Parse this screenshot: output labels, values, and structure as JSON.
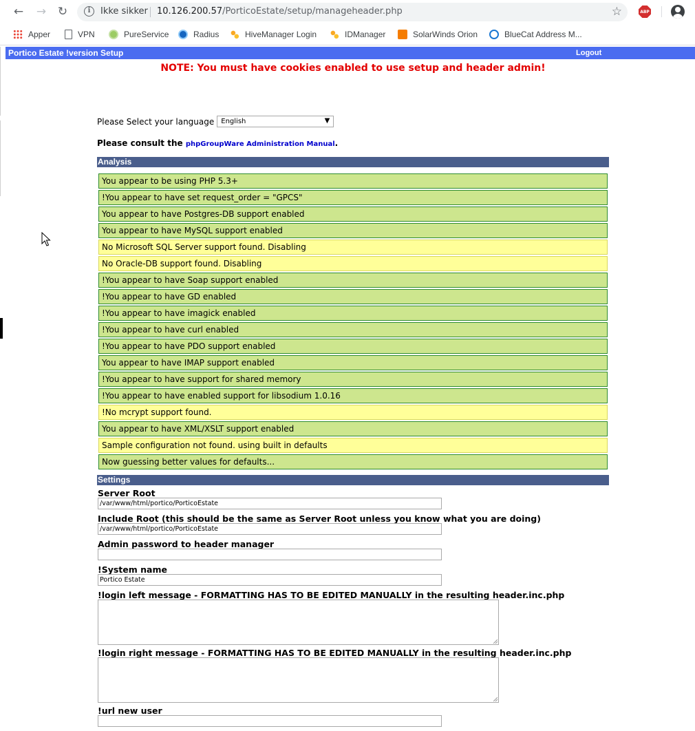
{
  "browser": {
    "nav": {
      "back": "←",
      "forward": "→",
      "reload": "↻"
    },
    "omnibox": {
      "security_label": "Ikke sikker",
      "host": "10.126.200.57",
      "path": "/PorticoEstate/setup/manageheader.php"
    },
    "star": "☆",
    "abp_label": "ABP",
    "bookmarks": [
      {
        "label": "Apper",
        "icon": "apps-grid-icon"
      },
      {
        "label": "VPN",
        "icon": "document-icon"
      },
      {
        "label": "PureService",
        "icon": "pureservice-icon"
      },
      {
        "label": "Radius",
        "icon": "radius-icon"
      },
      {
        "label": "HiveManager Login",
        "icon": "hivemanager-icon"
      },
      {
        "label": "IDManager",
        "icon": "idmanager-icon"
      },
      {
        "label": "SolarWinds Orion",
        "icon": "solarwinds-icon"
      },
      {
        "label": "BlueCat Address M...",
        "icon": "bluecat-icon"
      }
    ]
  },
  "header": {
    "title": "Portico Estate !version Setup",
    "logout": "Logout"
  },
  "note": "NOTE: You must have cookies enabled to use setup and header admin!",
  "language": {
    "label": "Please Select your language",
    "selected": "English"
  },
  "consult": {
    "prefix": "Please consult the ",
    "link": "phpGroupWare Administration Manual",
    "suffix": "."
  },
  "analysis": {
    "title": "Analysis",
    "rows": [
      {
        "text": "You appear to be using PHP 5.3+",
        "status": "ok"
      },
      {
        "text": "!You appear to have set request_order = \"GPCS\"",
        "status": "ok"
      },
      {
        "text": "You appear to have Postgres-DB support enabled",
        "status": "ok"
      },
      {
        "text": "You appear to have MySQL support enabled",
        "status": "ok"
      },
      {
        "text": "No Microsoft SQL Server support found. Disabling",
        "status": "warn"
      },
      {
        "text": "No Oracle-DB support found. Disabling",
        "status": "warn"
      },
      {
        "text": "!You appear to have Soap support enabled",
        "status": "ok"
      },
      {
        "text": "!You appear to have GD enabled",
        "status": "ok"
      },
      {
        "text": "!You appear to have imagick enabled",
        "status": "ok"
      },
      {
        "text": "!You appear to have curl enabled",
        "status": "ok"
      },
      {
        "text": "!You appear to have PDO support enabled",
        "status": "ok"
      },
      {
        "text": "You appear to have IMAP support enabled",
        "status": "ok"
      },
      {
        "text": "!You appear to have support for shared memory",
        "status": "ok"
      },
      {
        "text": "!You appear to have enabled support for libsodium 1.0.16",
        "status": "ok"
      },
      {
        "text": "!No mcrypt support found.",
        "status": "warn"
      },
      {
        "text": "You appear to have XML/XSLT support enabled",
        "status": "ok"
      },
      {
        "text": "Sample configuration not found. using built in defaults",
        "status": "warn"
      },
      {
        "text": "Now guessing better values for defaults...",
        "status": "ok"
      }
    ]
  },
  "settings": {
    "title": "Settings",
    "server_root": {
      "label": "Server Root",
      "value": "/var/www/html/portico/PorticoEstate"
    },
    "include_root": {
      "label": "Include Root (this should be the same as Server Root unless you know what you are doing)",
      "value": "/var/www/html/portico/PorticoEstate"
    },
    "admin_password": {
      "label": "Admin password to header manager",
      "value": ""
    },
    "system_name": {
      "label": "!System name",
      "value": "Portico Estate"
    },
    "login_left": {
      "label": "!login left message - FORMATTING HAS TO BE EDITED MANUALLY in the resulting header.inc.php",
      "value": ""
    },
    "login_right": {
      "label": "!login right message - FORMATTING HAS TO BE EDITED MANUALLY in the resulting header.inc.php",
      "value": ""
    },
    "url_new_user": {
      "label": "!url new user",
      "value": ""
    }
  }
}
